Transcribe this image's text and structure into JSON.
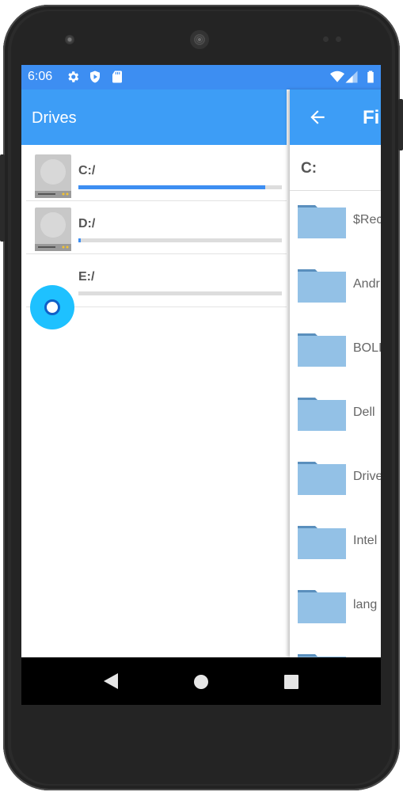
{
  "status_bar": {
    "time": "6:06",
    "left_icons": [
      "settings-icon",
      "shield-icon",
      "sd-card-icon"
    ],
    "right_icons": [
      "wifi-icon",
      "signal-icon",
      "battery-icon"
    ],
    "color": "#3d8ef2"
  },
  "drives_panel": {
    "title": "Drives",
    "accent": "#3d9df6",
    "drives": [
      {
        "label": "C:/",
        "usage": 0.92,
        "icon": "hard-drive-icon"
      },
      {
        "label": "D:/",
        "usage": 0.01,
        "icon": "hard-drive-icon"
      },
      {
        "label": "E:/",
        "usage": 0.0,
        "icon": "hard-drive-icon"
      }
    ]
  },
  "files_panel": {
    "title": "Fi",
    "path": "C:",
    "items": [
      {
        "name": "$Rec",
        "icon": "folder-icon"
      },
      {
        "name": "Andr",
        "icon": "folder-icon"
      },
      {
        "name": "BOLI",
        "icon": "folder-icon"
      },
      {
        "name": "Dell",
        "icon": "folder-icon"
      },
      {
        "name": "Drive",
        "icon": "folder-icon"
      },
      {
        "name": "Intel",
        "icon": "folder-icon"
      },
      {
        "name": "lang",
        "icon": "folder-icon"
      },
      {
        "name": "",
        "icon": "folder-icon"
      }
    ]
  },
  "nav_bar": {
    "buttons": [
      "back-icon",
      "home-icon",
      "recents-icon"
    ]
  }
}
